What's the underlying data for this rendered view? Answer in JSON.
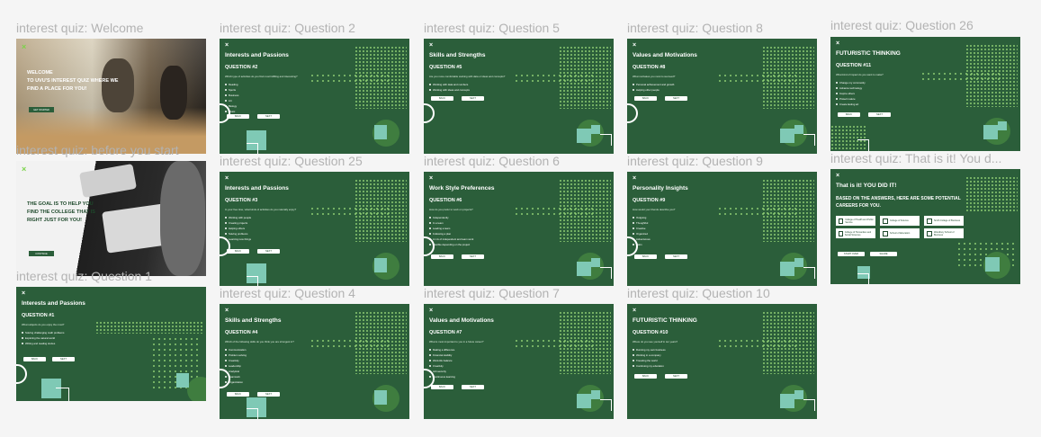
{
  "frames": {
    "welcome": {
      "label": "interest quiz: Welcome",
      "text": "WELCOME\nTO UVU'S INTEREST QUIZ WHERE WE\nFIND A PLACE FOR YOU!",
      "button": "GET STARTED"
    },
    "before": {
      "label": "interest quiz: before you start",
      "text": "THE GOAL IS TO HELP YOU\nFIND THE COLLEGE THAT IS\nRIGHT JUST FOR YOU!",
      "button": "CONTINUE"
    },
    "q1": {
      "label": "interest quiz: Question 1",
      "title": "Interests and Passions",
      "question": "QUESTION #1",
      "prompt": "What subjects do you enjoy the most?",
      "options": [
        "Solving challenging math problems",
        "Exploring the natural world",
        "Writing and reading stories"
      ]
    },
    "q2": {
      "label": "interest quiz: Question 2",
      "title": "Interests and Passions",
      "question": "QUESTION #2",
      "prompt": "Which type of activities do you find most fulfilling and interesting?",
      "options": [
        "Reading",
        "Sports",
        "Business",
        "Art",
        "Biology",
        "Music"
      ]
    },
    "q25": {
      "label": "interest quiz: Question 25",
      "title": "Interests and Passions",
      "question": "QUESTION #3",
      "prompt": "In your free time, what kinds of activities do you naturally enjoy?",
      "options": [
        "Working with people",
        "Creating projects",
        "Helping others",
        "Solving problems",
        "Learning new things"
      ]
    },
    "q4": {
      "label": "interest quiz: Question 4",
      "title": "Skills and Strengths",
      "question": "QUESTION #4",
      "prompt": "Which of the following skills do you think you are strongest in?",
      "options": [
        "Communication",
        "Problem solving",
        "Creativity",
        "Leadership",
        "Analytical",
        "Teamwork",
        "Organization"
      ]
    },
    "q5": {
      "label": "interest quiz: Question 5",
      "title": "Skills and Strengths",
      "question": "QUESTION #5",
      "prompt": "Are you more comfortable working with data or ideas and concepts?",
      "options": [
        "Working with data and numbers",
        "Working with ideas and concepts"
      ]
    },
    "q6": {
      "label": "interest quiz: Question 6",
      "title": "Work Style Preferences",
      "question": "QUESTION #6",
      "prompt": "How do you prefer to work on projects?",
      "options": [
        "Independently",
        "In a team",
        "Leading a team",
        "Following a plan",
        "A mix of independent and team work",
        "Flexible depending on the project"
      ]
    },
    "q7": {
      "label": "interest quiz: Question 7",
      "title": "Values and Motivations",
      "question": "QUESTION #7",
      "prompt": "What is most important to you in a future career?",
      "options": [
        "Making a difference",
        "Financial stability",
        "Work-life balance",
        "Creativity",
        "Job security",
        "Continuous learning"
      ]
    },
    "q8": {
      "label": "interest quiz: Question 8",
      "title": "Values and Motivations",
      "question": "QUESTION #8",
      "prompt": "What motivates you most to succeed?",
      "options": [
        "Personal achievement and growth",
        "Helping other people"
      ]
    },
    "q9": {
      "label": "interest quiz: Question 9",
      "title": "Personality Insights",
      "question": "QUESTION #9",
      "prompt": "How would your friends describe you?",
      "options": [
        "Outgoing",
        "Thoughtful",
        "Creative",
        "Organized",
        "Adventurous",
        "Calm"
      ]
    },
    "q10": {
      "label": "interest quiz: Question 10",
      "title": "FUTURISTIC THINKING",
      "question": "QUESTION #10",
      "prompt": "Where do you see yourself in ten years?",
      "options": [
        "Running my own business",
        "Working in a company",
        "Traveling the world",
        "Continuing my education"
      ]
    },
    "q26": {
      "label": "interest quiz: Question 26",
      "title": "FUTURISTIC THINKING",
      "question": "QUESTION #11",
      "prompt": "What kind of impact do you want to make?",
      "options": [
        "Change my community",
        "Advance technology",
        "Inspire others",
        "Protect nature",
        "Create lasting art"
      ]
    },
    "done": {
      "label": "interest quiz: That is it! You d...",
      "title": "That is it! YOU DID IT!",
      "heading": "BASED ON THE ANSWERS, HERE ARE SOME POTENTIAL CAREERS FOR YOU.",
      "cards": [
        "College of Health and Public Service",
        "College of Science",
        "Smith College of Business",
        "College of Humanities and Social Sciences",
        "School of Education",
        "Woodbury School of Business"
      ],
      "start_over": "START OVER",
      "share": "SHARE"
    }
  },
  "common": {
    "back": "BACK",
    "next": "NEXT",
    "close": "×"
  },
  "colors": {
    "green": "#2b5e3a",
    "teal": "#7fc9b5",
    "canvas": "#f5f5f5",
    "accent": "#7bd34a"
  }
}
